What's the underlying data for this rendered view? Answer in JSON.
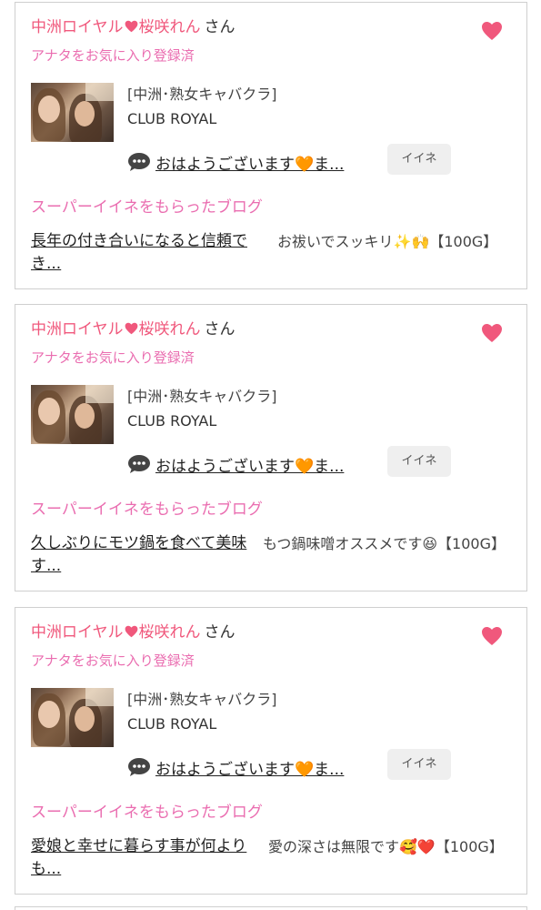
{
  "colors": {
    "pink": "#f0587c",
    "light_pink": "#ea6db0",
    "button_bg": "#efefef"
  },
  "icons": {
    "favorite": "heart-icon",
    "inline": "small-heart-icon",
    "message": "speech-bubble-icon"
  },
  "cards": [
    {
      "name_part1": "中洲ロイヤル",
      "name_part2": "桜咲れん",
      "honorific": "さん",
      "fav_status": "アナタをお気に入り登録済",
      "shop_category": "[中洲･熟女キャバクラ]",
      "shop_name": "CLUB ROYAL",
      "message": "おはようございます🧡ま...",
      "iine_label": "イイネ",
      "super_heading": "スーパーイイネをもらったブログ",
      "blog_title": "長年の付き合いになると信頼でき...",
      "blog_comment": "お祓いでスッキリ✨🙌【100G】"
    },
    {
      "name_part1": "中洲ロイヤル",
      "name_part2": "桜咲れん",
      "honorific": "さん",
      "fav_status": "アナタをお気に入り登録済",
      "shop_category": "[中洲･熟女キャバクラ]",
      "shop_name": "CLUB ROYAL",
      "message": "おはようございます🧡ま...",
      "iine_label": "イイネ",
      "super_heading": "スーパーイイネをもらったブログ",
      "blog_title": "久しぶりにモツ鍋を食べて美味す...",
      "blog_comment": "もつ鍋味噌オススメです😆【100G】"
    },
    {
      "name_part1": "中洲ロイヤル",
      "name_part2": "桜咲れん",
      "honorific": "さん",
      "fav_status": "アナタをお気に入り登録済",
      "shop_category": "[中洲･熟女キャバクラ]",
      "shop_name": "CLUB ROYAL",
      "message": "おはようございます🧡ま...",
      "iine_label": "イイネ",
      "super_heading": "スーパーイイネをもらったブログ",
      "blog_title": "愛娘と幸せに暮らす事が何よりも...",
      "blog_comment": "愛の深さは無限です🥰❤️【100G】"
    }
  ]
}
